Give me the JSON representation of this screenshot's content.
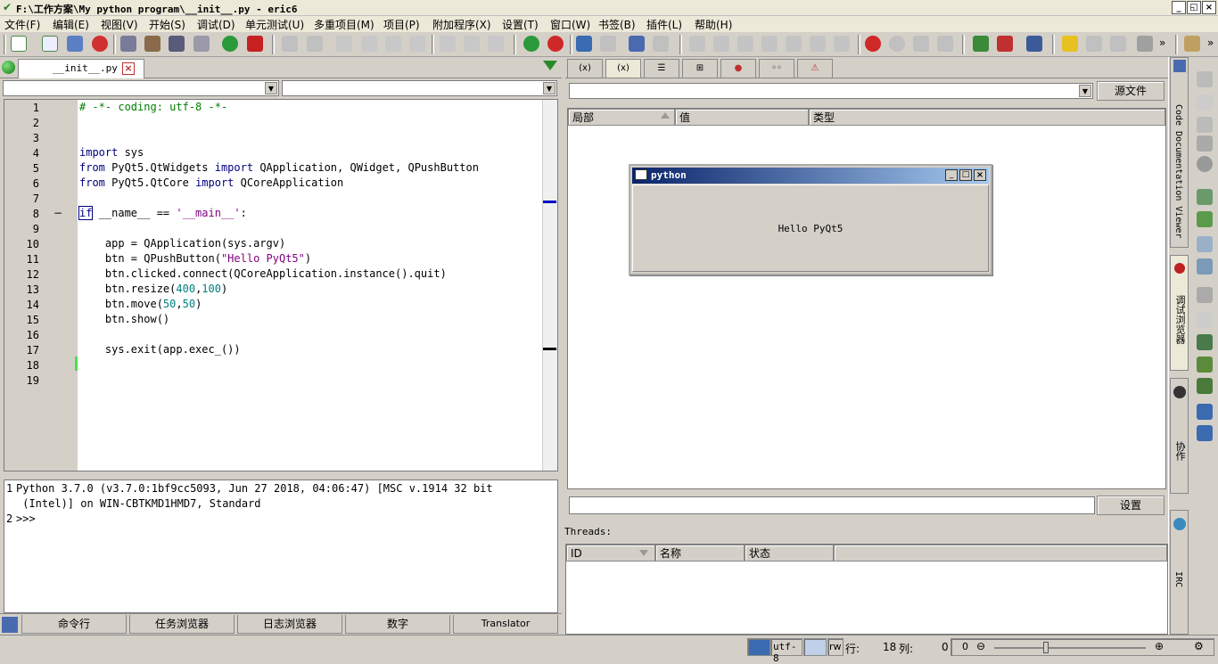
{
  "window": {
    "title": "F:\\工作方案\\My python program\\__init__.py - eric6",
    "buttons": {
      "minimize": "_",
      "restore": "◱",
      "close": "×"
    }
  },
  "menu": [
    "文件(F)",
    "编辑(E)",
    "视图(V)",
    "开始(S)",
    "调试(D)",
    "单元测试(U)",
    "多重项目(M)",
    "项目(P)",
    "附加程序(X)",
    "设置(T)",
    "窗口(W)",
    "书签(B)",
    "插件(L)",
    "帮助(H)"
  ],
  "editor": {
    "tab_label": "__init__.py",
    "line_numbers": [
      "1",
      "2",
      "3",
      "4",
      "5",
      "6",
      "7",
      "8",
      "9",
      "10",
      "11",
      "12",
      "13",
      "14",
      "15",
      "16",
      "17",
      "18",
      "19"
    ],
    "fold_marker": "−"
  },
  "shell": {
    "lines": [
      {
        "num": "1",
        "text": "Python 3.7.0 (v3.7.0:1bf9cc5093, Jun 27 2018, 04:06:47) [MSC v.1914 32 bit"
      },
      {
        "num": "",
        "text": " (Intel)] on WIN-CBTKMD1HMD7, Standard"
      },
      {
        "num": "2",
        "text": ">>>"
      }
    ]
  },
  "bottom_tabs": [
    "命令行",
    "任务浏览器",
    "日志浏览器",
    "数字",
    "Translator"
  ],
  "debug_viewer": {
    "source_button": "源文件",
    "columns": [
      "局部",
      "值",
      "类型"
    ],
    "filter_button": "设置",
    "threads_label": "Threads:",
    "thread_columns": [
      "ID",
      "名称",
      "状态"
    ]
  },
  "popup": {
    "title": "python",
    "button_text": "Hello PyQt5"
  },
  "side_tabs": [
    "Code Documentation Viewer",
    "调试浏览器",
    "协作",
    "IRC"
  ],
  "status": {
    "encoding": "utf-8",
    "mode": "rw",
    "line_label": "行:",
    "line_value": "18",
    "col_label": "列:",
    "col_value": "0",
    "zoom": "0"
  },
  "colors": {
    "keyword": "#00007f",
    "string": "#7f007f",
    "number": "#007f7f",
    "comment": "#007f00",
    "popup_title_start": "#0a246a",
    "popup_title_end": "#a6caf0"
  }
}
